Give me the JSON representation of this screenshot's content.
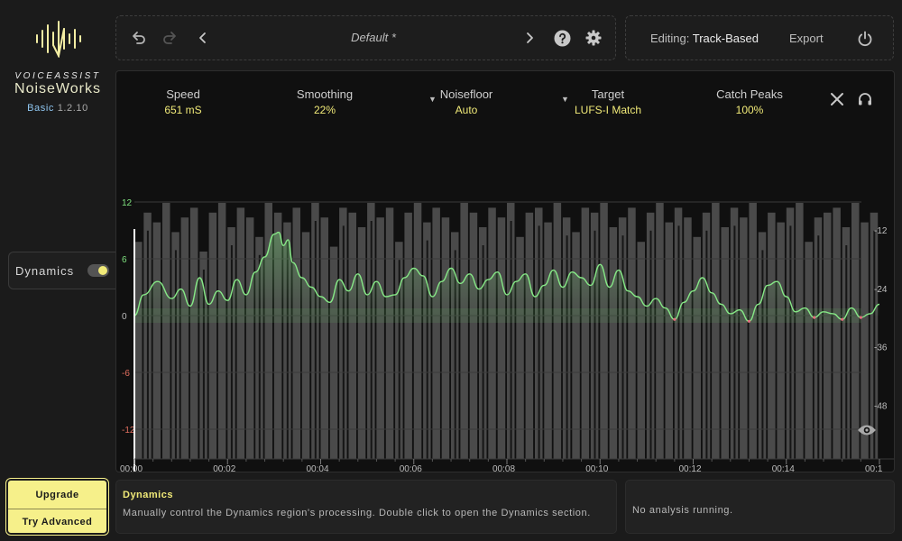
{
  "brand": {
    "top": "VOICEASSIST",
    "name": "NoiseWorks",
    "tier": "Basic",
    "version": "1.2.10"
  },
  "sidebar": {
    "dynamics_label": "Dynamics",
    "dynamics_enabled": true
  },
  "upgrade": {
    "upgrade_label": "Upgrade",
    "try_label": "Try Advanced"
  },
  "toolbar": {
    "preset_name": "Default *",
    "editing_prefix": "Editing:",
    "editing_mode": "Track-Based",
    "export_label": "Export"
  },
  "params": [
    {
      "label": "Speed",
      "value": "651 mS",
      "dropdown": false
    },
    {
      "label": "Smoothing",
      "value": "22%",
      "dropdown": false
    },
    {
      "label": "Noisefloor",
      "value": "Auto",
      "dropdown": true
    },
    {
      "label": "Target",
      "value": "LUFS-I Match",
      "dropdown": true
    },
    {
      "label": "Catch Peaks",
      "value": "100%",
      "dropdown": false
    }
  ],
  "chart_data": {
    "type": "area",
    "left_axis_ticks": [
      "12",
      "6",
      "0",
      "-6",
      "-12"
    ],
    "left_axis_values": [
      12,
      6,
      0,
      -6,
      -12
    ],
    "right_axis_ticks": [
      "-12",
      "-24",
      "-36",
      "-48"
    ],
    "right_axis_values": [
      -12,
      -24,
      -36,
      -48
    ],
    "x_ticks": [
      "00:00",
      "00:02",
      "00:04",
      "00:06",
      "00:08",
      "00:10",
      "00:12",
      "00:14",
      "00:1"
    ],
    "x_tick_seconds": [
      0,
      2,
      4,
      6,
      8,
      10,
      12,
      14,
      16
    ],
    "ylim_left": [
      -15,
      14
    ],
    "gain_curve": {
      "x": [
        0,
        0.2,
        0.5,
        0.8,
        1.0,
        1.2,
        1.4,
        1.6,
        1.8,
        2.0,
        2.2,
        2.4,
        2.6,
        2.8,
        3.0,
        3.1,
        3.2,
        3.3,
        3.4,
        3.6,
        3.8,
        4.0,
        4.2,
        4.4,
        4.6,
        4.8,
        5.0,
        5.2,
        5.4,
        5.6,
        5.8,
        6.0,
        6.2,
        6.4,
        6.6,
        6.8,
        7.0,
        7.2,
        7.4,
        7.6,
        7.8,
        8.0,
        8.2,
        8.4,
        8.6,
        8.8,
        9.0,
        9.2,
        9.4,
        9.6,
        9.8,
        10.0,
        10.2,
        10.4,
        10.6,
        10.8,
        11.0,
        11.2,
        11.4,
        11.6,
        11.8,
        12.0,
        12.2,
        12.4,
        12.6,
        12.8,
        13.0,
        13.2,
        13.4,
        13.6,
        13.8,
        14.0,
        14.2,
        14.4,
        14.6,
        14.8,
        15.0,
        15.2,
        15.4,
        15.6,
        15.8,
        16.0
      ],
      "y": [
        0,
        2.2,
        3.6,
        1.8,
        2.8,
        1.0,
        4.0,
        1.2,
        2.6,
        1.6,
        3.8,
        2.2,
        4.6,
        6.2,
        8.6,
        8.8,
        7.4,
        8.0,
        5.6,
        4.0,
        3.0,
        2.0,
        1.4,
        3.8,
        2.6,
        4.4,
        2.2,
        3.6,
        2.0,
        2.2,
        4.0,
        5.0,
        4.2,
        2.0,
        3.6,
        5.0,
        3.4,
        4.4,
        2.8,
        3.8,
        4.6,
        2.2,
        3.6,
        4.4,
        2.0,
        3.2,
        4.8,
        3.0,
        4.6,
        4.0,
        3.2,
        5.4,
        3.0,
        4.8,
        2.6,
        2.0,
        1.0,
        1.8,
        0.8,
        -0.4,
        1.4,
        2.6,
        4.0,
        2.4,
        1.2,
        0.2,
        0.6,
        -0.6,
        1.2,
        3.2,
        3.6,
        2.0,
        0.4,
        0.8,
        -0.2,
        0.4,
        0.2,
        -0.4,
        0.8,
        -0.2,
        0.2,
        1.2
      ]
    },
    "waveform_peaks_dbfs": [
      -20,
      -14,
      -16,
      -12,
      -18,
      -15,
      -13,
      -22,
      -14,
      -12,
      -17,
      -13,
      -15,
      -19,
      -12,
      -14,
      -16,
      -13,
      -18,
      -12,
      -15,
      -21,
      -13,
      -14,
      -17,
      -12,
      -15,
      -13,
      -20,
      -14,
      -12,
      -16,
      -13,
      -15,
      -18,
      -12,
      -14,
      -17,
      -13,
      -15,
      -12,
      -19,
      -14,
      -13,
      -16,
      -12,
      -15,
      -18,
      -13,
      -14,
      -12,
      -17,
      -15,
      -13,
      -20,
      -14,
      -12,
      -16,
      -13,
      -15,
      -19,
      -14,
      -12,
      -17,
      -13,
      -15,
      -12,
      -18,
      -14,
      -16,
      -13,
      -12,
      -20,
      -15,
      -14,
      -13,
      -17,
      -12,
      -16,
      -14
    ]
  },
  "info_panel": {
    "title": "Dynamics",
    "description": "Manually control the Dynamics region's processing. Double click to open the Dynamics section."
  },
  "status_panel": {
    "text": "No analysis running."
  },
  "colors": {
    "accent_yellow": "#f1ea78",
    "curve_green": "#7fe27f",
    "curve_red": "#e26f7f",
    "upgrade_bg": "#f6f08a"
  }
}
